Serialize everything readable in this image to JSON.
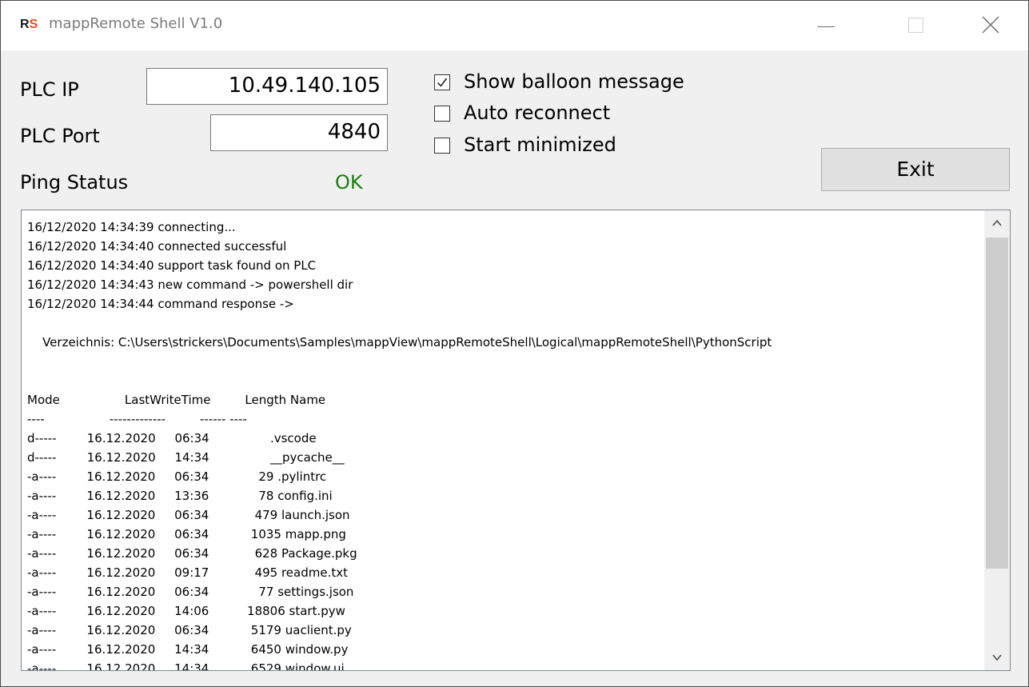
{
  "window": {
    "title": "mappRemote Shell V1.0",
    "logo": {
      "r": "R",
      "s": "S"
    }
  },
  "connection": {
    "plc_ip_label": "PLC IP",
    "plc_ip_value": "10.49.140.105",
    "plc_port_label": "PLC Port",
    "plc_port_value": "4840",
    "ping_status_label": "Ping Status",
    "ping_status_value": "OK"
  },
  "options": [
    {
      "label": "Show balloon message",
      "checked": true
    },
    {
      "label": "Auto reconnect",
      "checked": false
    },
    {
      "label": "Start minimized",
      "checked": false
    }
  ],
  "buttons": {
    "exit_label": "Exit"
  },
  "log": {
    "lines": [
      "16/12/2020 14:34:39 connecting...",
      "16/12/2020 14:34:40 connected successful",
      "16/12/2020 14:34:40 support task found on PLC",
      "16/12/2020 14:34:43 new command -> powershell dir",
      "16/12/2020 14:34:44 command response ->",
      "",
      "    Verzeichnis: C:\\Users\\strickers\\Documents\\Samples\\mappView\\mappRemoteShell\\Logical\\mappRemoteShell\\PythonScript",
      "",
      "",
      "Mode                 LastWriteTime         Length Name",
      "----                 -------------         ------ ----",
      "d-----        16.12.2020     06:34                .vscode",
      "d-----        16.12.2020     14:34                __pycache__",
      "-a----        16.12.2020     06:34             29 .pylintrc",
      "-a----        16.12.2020     13:36             78 config.ini",
      "-a----        16.12.2020     06:34            479 launch.json",
      "-a----        16.12.2020     06:34           1035 mapp.png",
      "-a----        16.12.2020     06:34            628 Package.pkg",
      "-a----        16.12.2020     09:17            495 readme.txt",
      "-a----        16.12.2020     06:34             77 settings.json",
      "-a----        16.12.2020     14:06          18806 start.pyw",
      "-a----        16.12.2020     06:34           5179 uaclient.py",
      "-a----        16.12.2020     14:34           6450 window.py",
      "-a----        16.12.2020     14:34           6529 window.ui"
    ]
  },
  "colors": {
    "status_ok": "#17820e",
    "logo_accent": "#e64a19",
    "window_bg": "#f0f0f0"
  }
}
